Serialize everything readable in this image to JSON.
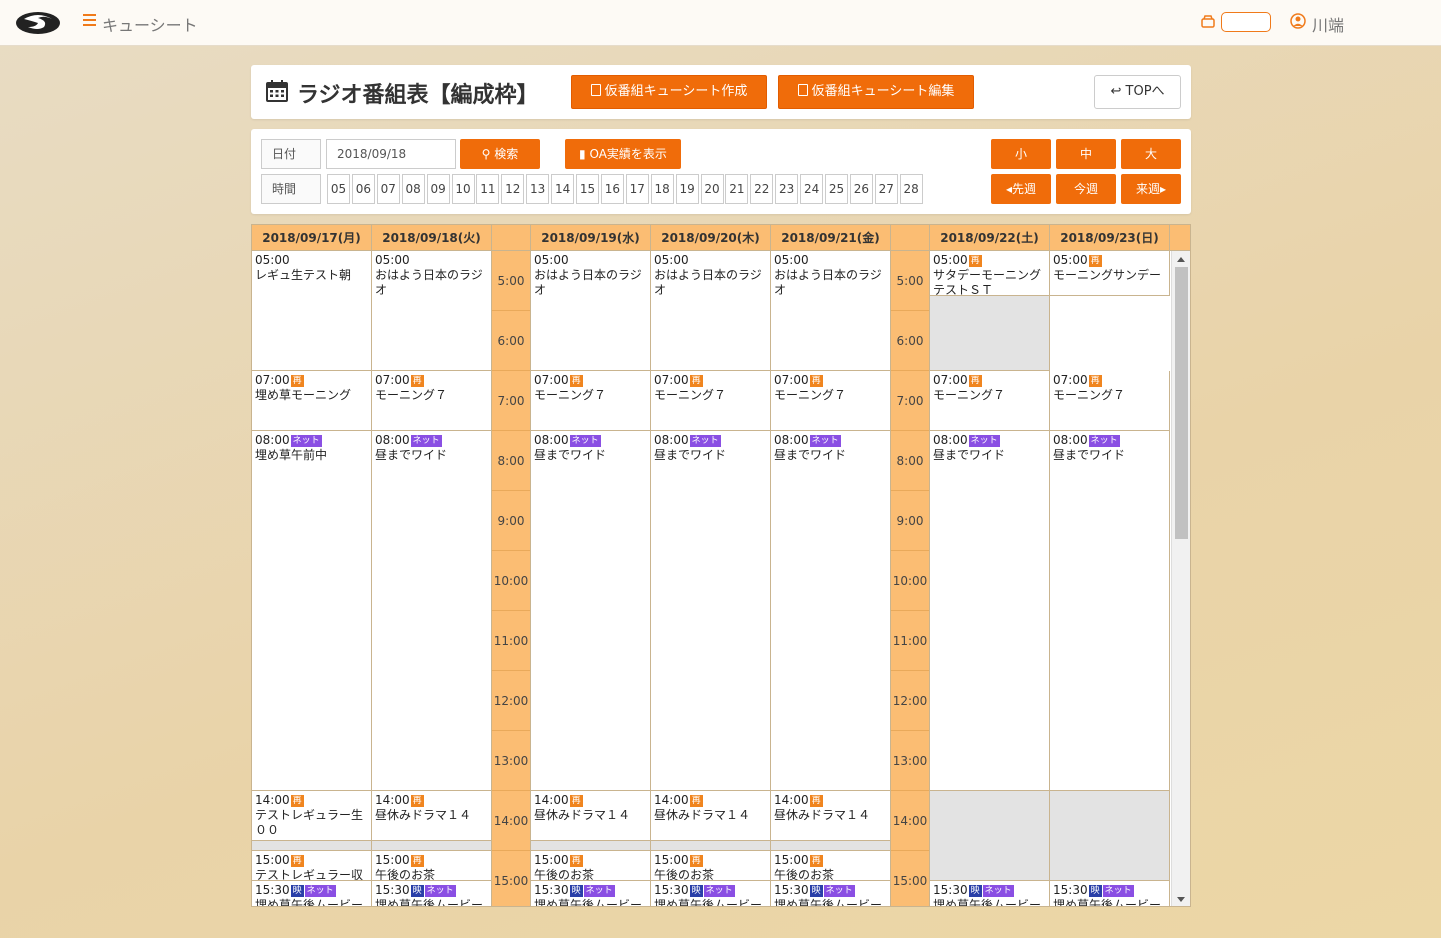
{
  "app": {
    "title": "キューシート",
    "user": "川端"
  },
  "header": {
    "title": "ラジオ番組表【編成枠】",
    "create_btn": "仮番組キューシート作成",
    "edit_btn": "仮番組キューシート編集",
    "top_btn": "TOPへ"
  },
  "search": {
    "date_label": "日付",
    "date_value": "2018/09/18",
    "search_btn": "検索",
    "oa_btn": "OA実績を表示",
    "time_label": "時間",
    "hours": [
      "05",
      "06",
      "07",
      "08",
      "09",
      "10",
      "11",
      "12",
      "13",
      "14",
      "15",
      "16",
      "17",
      "18",
      "19",
      "20",
      "21",
      "22",
      "23",
      "24",
      "25",
      "26",
      "27",
      "28"
    ],
    "size_small": "小",
    "size_mid": "中",
    "size_large": "大",
    "prev_week": "先週",
    "this_week": "今週",
    "next_week": "来週"
  },
  "schedule": {
    "days": [
      "2018/09/17(月)",
      "2018/09/18(火)",
      "2018/09/19(水)",
      "2018/09/20(木)",
      "2018/09/21(金)",
      "2018/09/22(土)",
      "2018/09/23(日)"
    ],
    "times": [
      "5:00",
      "6:00",
      "7:00",
      "8:00",
      "9:00",
      "10:00",
      "11:00",
      "12:00",
      "13:00",
      "14:00",
      "15:00"
    ],
    "columns": [
      [
        {
          "time": "05:00",
          "name": "レギュ生テスト朝",
          "tags": []
        },
        {
          "time": "07:00",
          "name": "埋め草モーニング",
          "tags": [
            "re"
          ]
        },
        {
          "time": "08:00",
          "name": "埋め草午前中",
          "tags": [
            "net"
          ]
        },
        {
          "time": "14:00",
          "name": "テストレギュラー生００",
          "tags": [
            "re"
          ]
        },
        {
          "time": "15:00",
          "name": "テストレギュラー収",
          "tags": [
            "re"
          ]
        },
        {
          "time": "15:30",
          "name": "埋め草午後ムービー",
          "tags": [
            "ei",
            "net"
          ]
        }
      ],
      [
        {
          "time": "05:00",
          "name": "おはよう日本のラジオ",
          "tags": []
        },
        {
          "time": "07:00",
          "name": "モーニング７",
          "tags": [
            "re"
          ]
        },
        {
          "time": "08:00",
          "name": "昼までワイド",
          "tags": [
            "net"
          ]
        },
        {
          "time": "14:00",
          "name": "昼休みドラマ１４",
          "tags": [
            "re"
          ]
        },
        {
          "time": "15:00",
          "name": "午後のお茶",
          "tags": [
            "re"
          ]
        },
        {
          "time": "15:30",
          "name": "埋め草午後ムービー",
          "tags": [
            "ei",
            "net"
          ]
        }
      ],
      [
        {
          "time": "05:00",
          "name": "おはよう日本のラジオ",
          "tags": []
        },
        {
          "time": "07:00",
          "name": "モーニング７",
          "tags": [
            "re"
          ]
        },
        {
          "time": "08:00",
          "name": "昼までワイド",
          "tags": [
            "net"
          ]
        },
        {
          "time": "14:00",
          "name": "昼休みドラマ１４",
          "tags": [
            "re"
          ]
        },
        {
          "time": "15:00",
          "name": "午後のお茶",
          "tags": [
            "re"
          ]
        },
        {
          "time": "15:30",
          "name": "埋め草午後ムービー",
          "tags": [
            "ei",
            "net"
          ]
        }
      ],
      [
        {
          "time": "05:00",
          "name": "おはよう日本のラジオ",
          "tags": []
        },
        {
          "time": "07:00",
          "name": "モーニング７",
          "tags": [
            "re"
          ]
        },
        {
          "time": "08:00",
          "name": "昼までワイド",
          "tags": [
            "net"
          ]
        },
        {
          "time": "14:00",
          "name": "昼休みドラマ１４",
          "tags": [
            "re"
          ]
        },
        {
          "time": "15:00",
          "name": "午後のお茶",
          "tags": [
            "re"
          ]
        },
        {
          "time": "15:30",
          "name": "埋め草午後ムービー",
          "tags": [
            "ei",
            "net"
          ]
        }
      ],
      [
        {
          "time": "05:00",
          "name": "おはよう日本のラジオ",
          "tags": []
        },
        {
          "time": "07:00",
          "name": "モーニング７",
          "tags": [
            "re"
          ]
        },
        {
          "time": "08:00",
          "name": "昼までワイド",
          "tags": [
            "net"
          ]
        },
        {
          "time": "14:00",
          "name": "昼休みドラマ１４",
          "tags": [
            "re"
          ]
        },
        {
          "time": "15:00",
          "name": "午後のお茶",
          "tags": [
            "re"
          ]
        },
        {
          "time": "15:30",
          "name": "埋め草午後ムービー",
          "tags": [
            "ei",
            "net"
          ]
        }
      ],
      [
        {
          "time": "05:00",
          "name": "サタデーモーニングテストＳＴ",
          "tags": [
            "re"
          ]
        },
        {
          "time": "07:00",
          "name": "モーニング７",
          "tags": [
            "re"
          ]
        },
        {
          "time": "08:00",
          "name": "昼までワイド",
          "tags": [
            "net"
          ]
        },
        {
          "time": "15:30",
          "name": "埋め草午後ムービー",
          "tags": [
            "ei",
            "net"
          ]
        }
      ],
      [
        {
          "time": "05:00",
          "name": "モーニングサンデー",
          "tags": [
            "re"
          ]
        },
        {
          "time": "07:00",
          "name": "モーニング７",
          "tags": [
            "re"
          ]
        },
        {
          "time": "08:00",
          "name": "昼までワイド",
          "tags": [
            "net"
          ]
        },
        {
          "time": "15:30",
          "name": "埋め草午後ムービー",
          "tags": [
            "ei",
            "net"
          ]
        }
      ]
    ],
    "tag_labels": {
      "re": "再",
      "net": "ネット",
      "ei": "映"
    }
  },
  "colors": {
    "accent": "#f06c0a",
    "header_bg": "#fbbd73",
    "net_tag": "#8a4fe3",
    "re_tag": "#f0851f",
    "ei_tag": "#2a3fa8"
  }
}
